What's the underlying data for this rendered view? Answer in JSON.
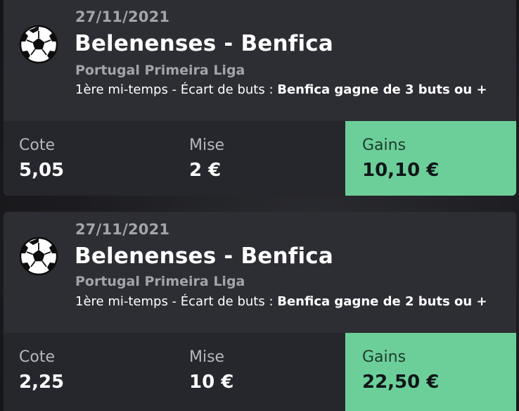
{
  "colors": {
    "card_bg": "#2d2e34",
    "band_bg": "#26272c",
    "gains_bg": "#6ccf99",
    "muted_text": "#a3a4ab",
    "text": "#ffffff"
  },
  "bets": [
    {
      "icon": "soccer-ball-icon",
      "date": "27/11/2021",
      "match": "Belenenses - Benfica",
      "league": "Portugal Primeira Liga",
      "market": "1ère mi-temps - Écart de buts : ",
      "selection": "Benfica gagne de 3 buts ou +",
      "cote_label": "Cote",
      "cote_value": "5,05",
      "mise_label": "Mise",
      "mise_value": "2 €",
      "gains_label": "Gains",
      "gains_value": "10,10 €"
    },
    {
      "icon": "soccer-ball-icon",
      "date": "27/11/2021",
      "match": "Belenenses - Benfica",
      "league": "Portugal Primeira Liga",
      "market": "1ère mi-temps - Écart de buts : ",
      "selection": "Benfica gagne de 2 buts ou +",
      "cote_label": "Cote",
      "cote_value": "2,25",
      "mise_label": "Mise",
      "mise_value": "10 €",
      "gains_label": "Gains",
      "gains_value": "22,50 €"
    }
  ]
}
